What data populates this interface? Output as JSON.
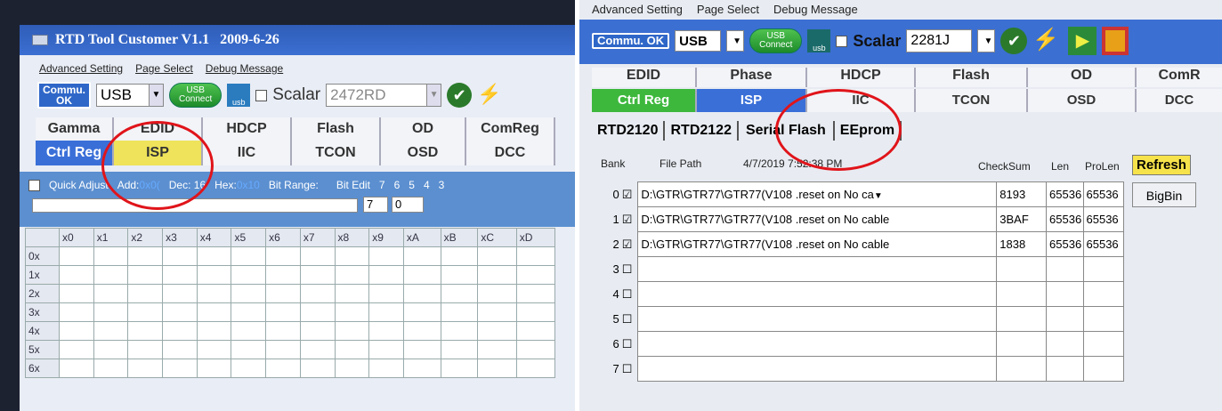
{
  "left": {
    "title": "RTD Tool Customer V1.1   2009-6-26",
    "menu": [
      "Advanced Setting",
      "Page Select",
      "Debug Message"
    ],
    "commu": "Commu.\nOK",
    "interface": "USB",
    "usb_connect": "USB\nConnect",
    "usb_icon_label": "usb",
    "scalar_label": "Scalar",
    "scalar_value": "2472RD",
    "tabs_top": [
      "Gamma",
      "EDID",
      "HDCP",
      "Flash",
      "OD",
      "ComReg"
    ],
    "tabs_bottom": [
      "Ctrl Reg",
      "ISP",
      "IIC",
      "TCON",
      "OSD",
      "DCC"
    ],
    "quick": {
      "label": "Quick Adjust",
      "addr_label": "Add:",
      "addr_value": "0x0(",
      "dec_label": "Dec:",
      "dec_value": "16",
      "hex_label": "Hex:",
      "hex_value": "0x10",
      "bit_range_label": "Bit Range:",
      "bit_range_from": "7",
      "bit_range_to": "0",
      "bit_edit_label": "Bit Edit",
      "bit_numbers": [
        "7",
        "6",
        "5",
        "4",
        "3"
      ]
    },
    "grid_cols": [
      "x0",
      "x1",
      "x2",
      "x3",
      "x4",
      "x5",
      "x6",
      "x7",
      "x8",
      "x9",
      "xA",
      "xB",
      "xC",
      "xD"
    ],
    "grid_rows": [
      "0x",
      "1x",
      "2x",
      "3x",
      "4x",
      "5x",
      "6x"
    ]
  },
  "right": {
    "menu": [
      "Advanced Setting",
      "Page Select",
      "Debug Message"
    ],
    "commu": "Commu.\nOK",
    "interface": "USB",
    "usb_connect": "USB\nConnect",
    "usb_icon_label": "usb",
    "scalar_label": "Scalar",
    "scalar_value": "2281J",
    "tabs_top": [
      "EDID",
      "Phase",
      "HDCP",
      "Flash",
      "OD",
      "ComR"
    ],
    "tabs_bottom": [
      "Ctrl Reg",
      "ISP",
      "IIC",
      "TCON",
      "OSD",
      "DCC"
    ],
    "sub_tabs": [
      "RTD2120",
      "RTD2122",
      "Serial Flash",
      "EEprom"
    ],
    "header": {
      "bank": "Bank",
      "file_path": "File Path",
      "datetime": "4/7/2019 7:52:38 PM",
      "checksum": "CheckSum",
      "len": "Len",
      "prolen": "ProLen",
      "refresh": "Refresh"
    },
    "bigbin": "BigBin",
    "rows": [
      {
        "bank": "0",
        "checked": "☑",
        "path": "D:\\GTR\\GTR77\\GTR77(V108 .reset  on No ca",
        "dropdown": "▼",
        "checksum": "8193",
        "len": "65536",
        "prolen": "65536"
      },
      {
        "bank": "1",
        "checked": "☑",
        "path": "D:\\GTR\\GTR77\\GTR77(V108 .reset  on No cable",
        "dropdown": "",
        "checksum": "3BAF",
        "len": "65536",
        "prolen": "65536"
      },
      {
        "bank": "2",
        "checked": "☑",
        "path": "D:\\GTR\\GTR77\\GTR77(V108 .reset  on No cable",
        "dropdown": "",
        "checksum": "1838",
        "len": "65536",
        "prolen": "65536"
      },
      {
        "bank": "3",
        "checked": "☐",
        "path": "",
        "dropdown": "",
        "checksum": "",
        "len": "",
        "prolen": ""
      },
      {
        "bank": "4",
        "checked": "☐",
        "path": "",
        "dropdown": "",
        "checksum": "",
        "len": "",
        "prolen": ""
      },
      {
        "bank": "5",
        "checked": "☐",
        "path": "",
        "dropdown": "",
        "checksum": "",
        "len": "",
        "prolen": ""
      },
      {
        "bank": "6",
        "checked": "☐",
        "path": "",
        "dropdown": "",
        "checksum": "",
        "len": "",
        "prolen": ""
      },
      {
        "bank": "7",
        "checked": "☐",
        "path": "",
        "dropdown": "",
        "checksum": "",
        "len": "",
        "prolen": ""
      }
    ]
  },
  "colors": {
    "annotation": "#e0141a",
    "tab_green": "#3db83d",
    "tab_yellow": "#eee35a",
    "tab_blue": "#3a6fd8"
  }
}
